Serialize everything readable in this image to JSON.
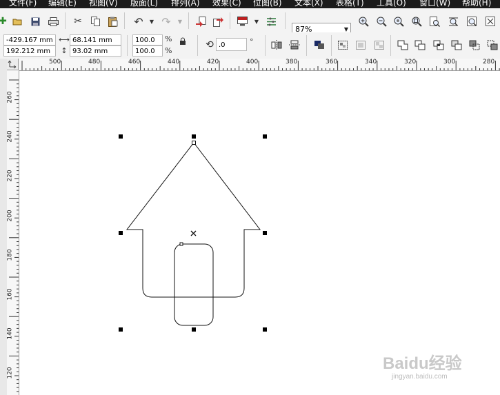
{
  "menu": [
    "文件(F)",
    "编辑(E)",
    "视图(V)",
    "版面(L)",
    "排列(A)",
    "效果(C)",
    "位图(B)",
    "文本(X)",
    "表格(T)",
    "工具(O)",
    "窗口(W)",
    "帮助(H)"
  ],
  "toolbar": {
    "zoom_value": "87%"
  },
  "property_bar": {
    "x_pos": "-429.167 mm",
    "y_pos": "192.212 mm",
    "width": "68.141 mm",
    "height": "93.02 mm",
    "scale_x": "100.0",
    "scale_y": "100.0",
    "percent": "%",
    "rotation": ".0",
    "degree": "°"
  },
  "ruler_h": [
    "500",
    "480",
    "460",
    "440",
    "420",
    "400",
    "380",
    "360",
    "340",
    "320",
    "300",
    "280"
  ],
  "ruler_v": [
    "260",
    "240",
    "220",
    "200",
    "180",
    "160",
    "140",
    "120"
  ],
  "watermark": {
    "brand": "Baidu经验",
    "url": "jingyan.baidu.com"
  },
  "colors": {
    "menubar": "#1b1b1b",
    "canvas": "#ffffff",
    "toolbar": "#f3f3f3"
  },
  "icons": [
    "new-icon",
    "open-icon",
    "save-icon",
    "print-icon",
    "cut-icon",
    "copy-icon",
    "paste-icon",
    "undo-icon",
    "redo-icon",
    "import-icon",
    "export-icon",
    "app-launcher-icon",
    "options-icon",
    "zoom-in-icon",
    "zoom-out-icon",
    "zoom-to-fit-icon",
    "zoom-selected-icon",
    "zoom-page-icon",
    "zoom-width-icon",
    "zoom-height-icon",
    "lock-ratio-icon",
    "rotate-icon",
    "mirror-horizontal-icon",
    "mirror-vertical-icon",
    "to-front-icon",
    "combine-icon",
    "break-apart-icon",
    "group-icon",
    "weld-icon",
    "trim-icon",
    "intersect-icon",
    "simplify-icon",
    "front-minus-back-icon",
    "back-minus-front-icon"
  ]
}
